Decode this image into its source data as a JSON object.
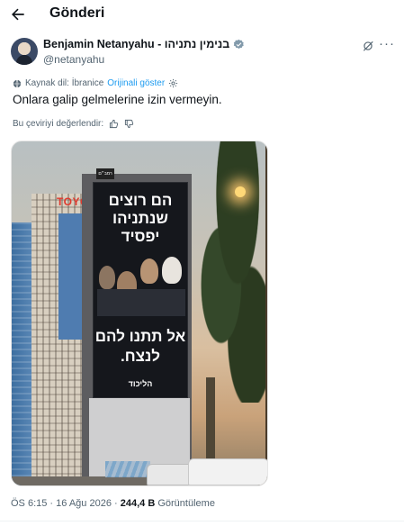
{
  "header": {
    "title": "Gönderi",
    "back_icon": "arrow-left-icon"
  },
  "author": {
    "display_name": "Benjamin Netanyahu - בנימין נתניהו",
    "handle": "@netanyahu",
    "verified_icon": "verified-badge-icon",
    "verified_color": "#829aab"
  },
  "translation": {
    "source_label": "Kaynak dil: İbranice",
    "show_original": "Orijinali göster",
    "settings_icon": "gear-icon"
  },
  "tweet": {
    "text": "Onlara galip gelmelerine izin vermeyin."
  },
  "rating": {
    "prompt": "Bu çeviriyi değerlendir:",
    "up_icon": "thumbs-up-icon",
    "down_icon": "thumbs-down-icon"
  },
  "media": {
    "building_sign": "TOYO",
    "billboard_headline": "הם רוצים שנתניהו יפסיד",
    "billboard_slogan": "אל תתנו להם לנצח.",
    "billboard_logo": "הליכוד",
    "tower_sign": "רמב״ם"
  },
  "meta": {
    "time": "ÖS 6:15",
    "date": "16 Ağu 2026",
    "separator": "·",
    "views_count": "244,4 B",
    "views_label": "Görüntüleme"
  },
  "colors": {
    "accent": "#1d9bf0",
    "muted": "#536471"
  }
}
